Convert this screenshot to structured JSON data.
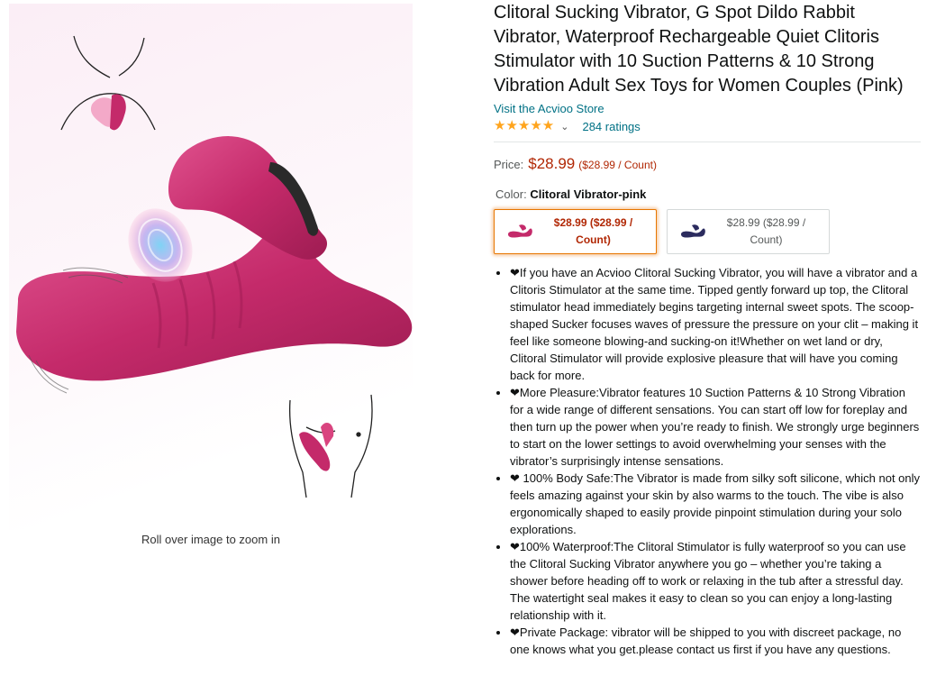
{
  "product": {
    "title": "Clitoral Sucking Vibrator, G Spot Dildo Rabbit Vibrator, Waterproof Rechargeable Quiet Clitoris Stimulator with 10 Suction Patterns & 10 Strong Vibration Adult Sex Toys for Women Couples (Pink)",
    "store_link": "Visit the Acvioo Store",
    "stars": "★★★★★",
    "ratings": "284 ratings",
    "price_label": "Price:",
    "price": "$28.99",
    "price_unit": "($28.99 / Count)",
    "color_label": "Color:",
    "color_value": "Clitoral Vibrator-pink"
  },
  "image": {
    "zoom_hint": "Roll over image to zoom in"
  },
  "swatches": [
    {
      "price_line1": "$28.99 ($28.99 /",
      "price_line2": "Count)",
      "selected": true,
      "color": "#c42a6a"
    },
    {
      "price_line1": "$28.99 ($28.99 /",
      "price_line2": "Count)",
      "selected": false,
      "color": "#2b2b5e"
    }
  ],
  "bullets": [
    "❤If you have an Acvioo Clitoral Sucking Vibrator, you will have a vibrator and a Clitoris Stimulator at the same time. Tipped gently forward up top, the Clitoral stimulator head immediately begins targeting internal sweet spots. The scoop-shaped Sucker focuses waves of pressure the pressure on your clit – making it feel like someone blowing-and sucking-on it!Whether on wet land or dry, Clitoral Stimulator will provide explosive pleasure that will have you coming back for more.",
    "❤More Pleasure:Vibrator features 10 Suction Patterns & 10 Strong Vibration for a wide range of different sensations. You can start off low for foreplay and then turn up the power when you’re ready to finish. We strongly urge beginners to start on the lower settings to avoid overwhelming your senses with the vibrator’s surprisingly intense sensations.",
    "❤ 100% Body Safe:The Vibrator is made from silky soft silicone, which not only feels amazing against your skin by also warms to the touch. The vibe is also ergonomically shaped to easily provide pinpoint stimulation during your solo explorations.",
    "❤100% Waterproof:The Clitoral Stimulator is fully waterproof so you can use the Clitoral Sucking Vibrator anywhere you go – whether you’re taking a shower before heading off to work or relaxing in the tub after a stressful day. The watertight seal makes it easy to clean so you can enjoy a long-lasting relationship with it.",
    "❤Private Package: vibrator will be shipped to you with discreet package, no one knows what you get.please contact us first if you have any questions."
  ],
  "colors": {
    "link": "#007185",
    "price": "#b12704",
    "star": "#ffa41c",
    "product_pink": "#c42a6a",
    "selected_border": "#e77600"
  }
}
